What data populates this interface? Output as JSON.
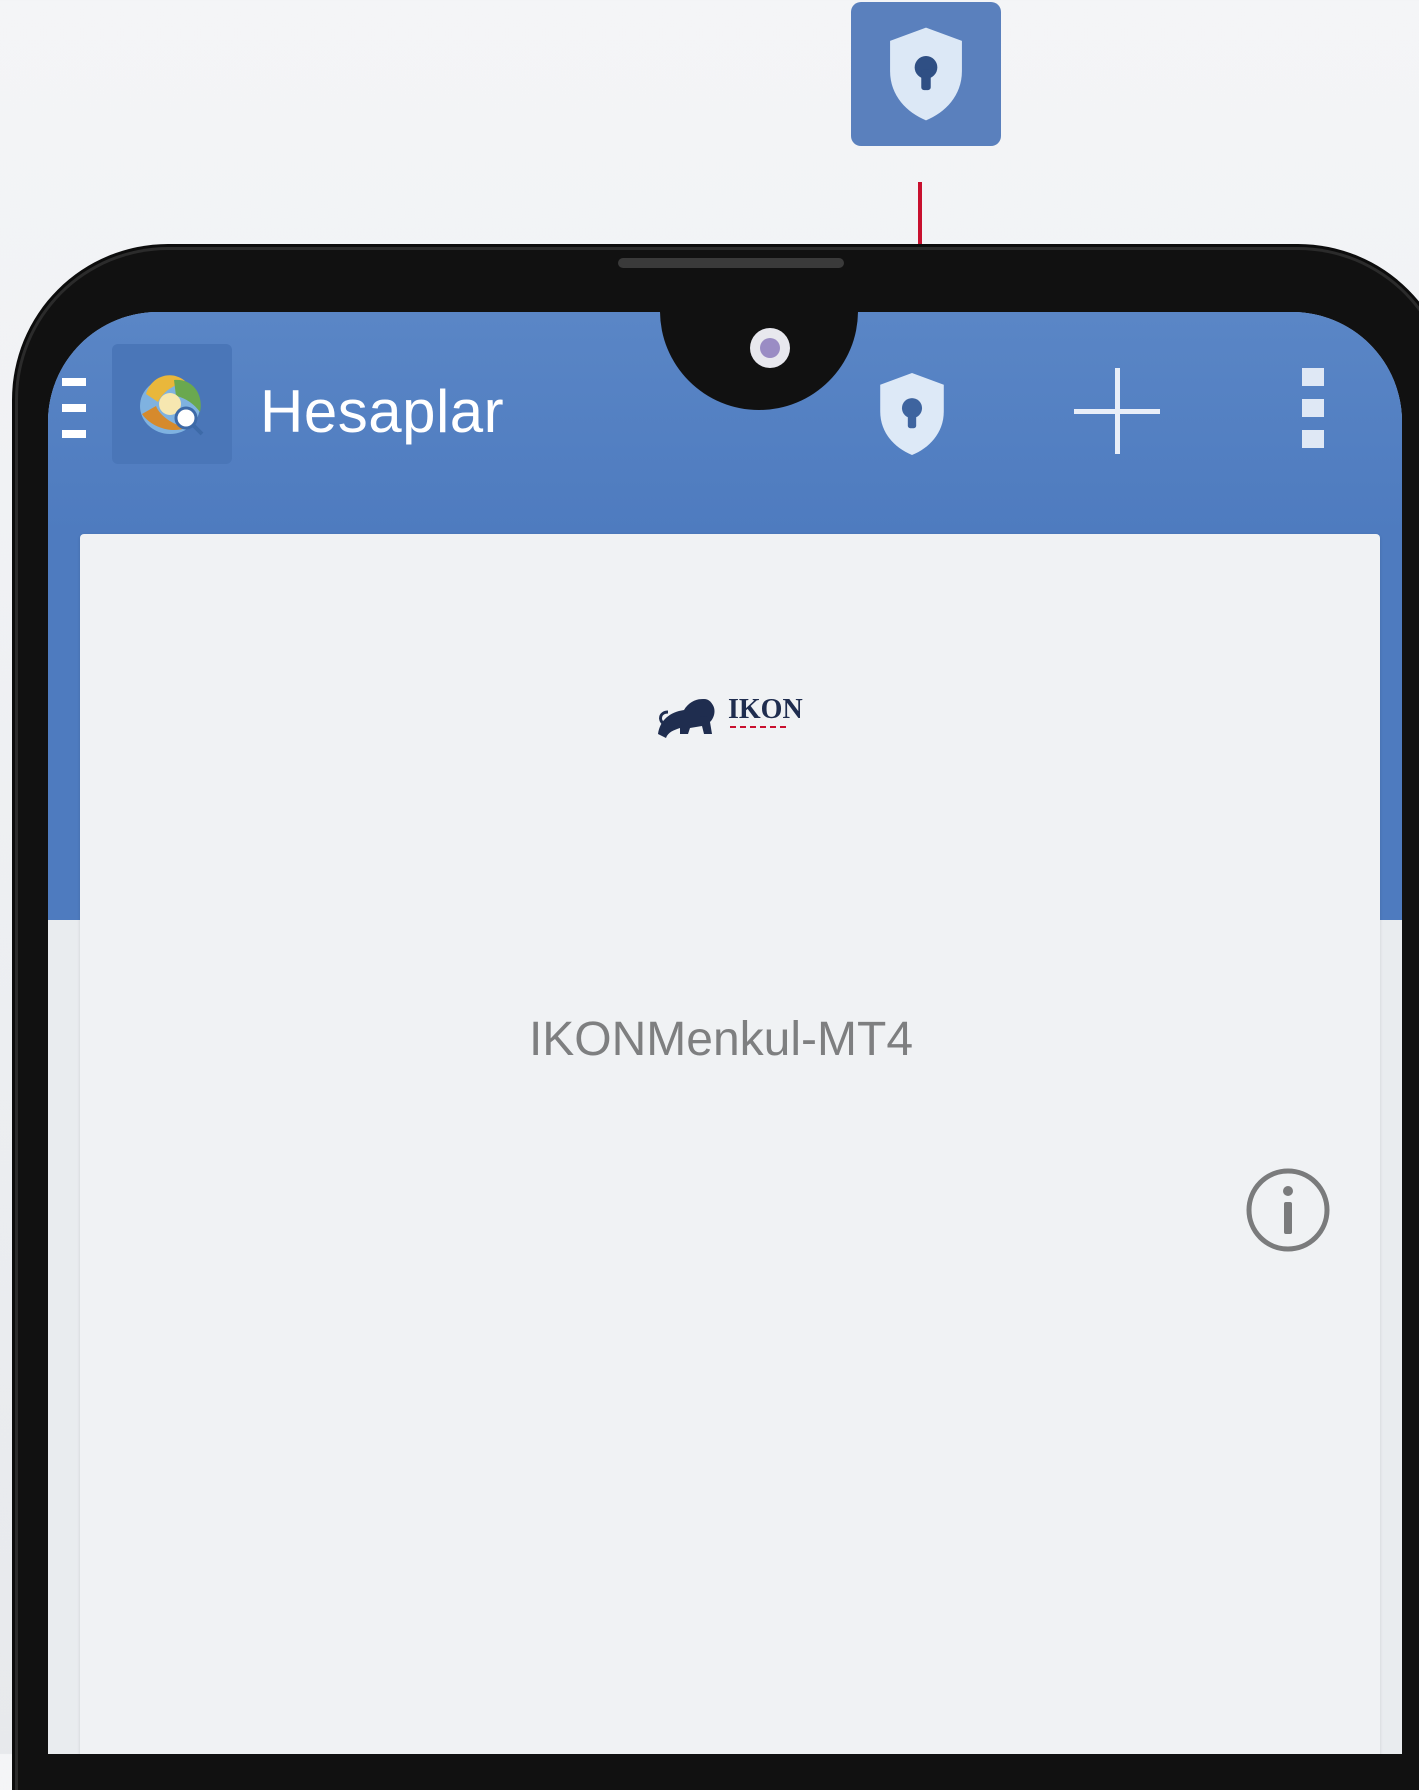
{
  "callout": {
    "icon": "shield-keyhole-icon",
    "line_color": "#c8102e"
  },
  "appbar": {
    "title": "Hesaplar",
    "background": "#4e7bbf",
    "menu_icon": "hamburger-icon",
    "app_icon": "metatrader-logo",
    "actions": {
      "security_icon": "shield-keyhole-icon",
      "add_icon": "plus-icon",
      "more_icon": "more-vertical-icon"
    }
  },
  "account_card": {
    "broker_logo_text": "IKON",
    "server": "IKONMenkul-MT4",
    "info_icon": "info-icon"
  }
}
